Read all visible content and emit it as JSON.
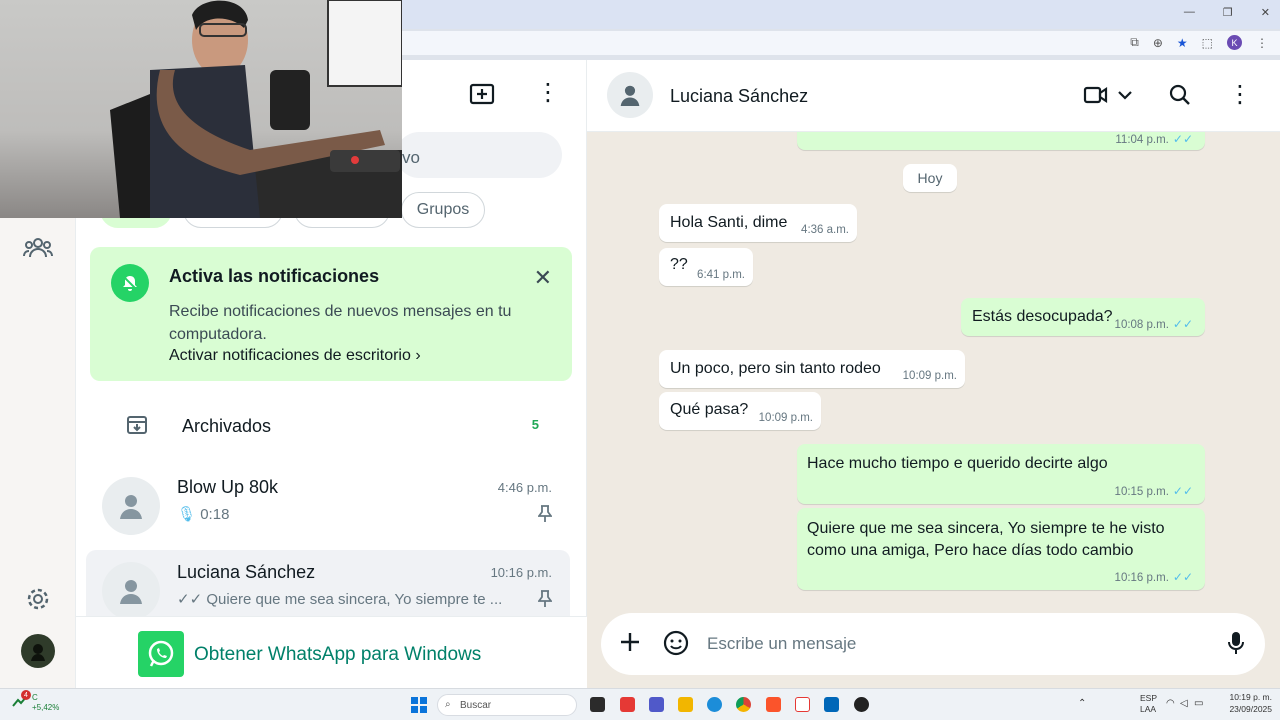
{
  "browser": {
    "profile_initial": "K"
  },
  "sidebar": {
    "search_placeholder_fragment": "vo",
    "chips": [
      {
        "label": ""
      },
      {
        "label": ""
      },
      {
        "label": ""
      },
      {
        "label": "Grupos"
      }
    ],
    "notification": {
      "title": "Activa las notificaciones",
      "body": "Recibe notificaciones de nuevos mensajes en tu computadora.",
      "link": "Activar notificaciones de escritorio"
    },
    "archived": {
      "label": "Archivados",
      "count": "5"
    },
    "chats": [
      {
        "name": "Blow Up 80k",
        "time": "4:46 p.m.",
        "preview": "0:18",
        "pinned": true
      },
      {
        "name": "Luciana Sánchez",
        "time": "10:16 p.m.",
        "preview": "Quiere que me sea sincera, Yo siempre te ...",
        "pinned": true
      }
    ],
    "get_windows": "Obtener WhatsApp para Windows"
  },
  "conversation": {
    "contact_name": "Luciana Sánchez",
    "top_partial_time": "11:04 p.m.",
    "day_label": "Hoy",
    "messages": [
      {
        "dir": "in",
        "text": "Hola Santi, dime",
        "time": "4:36 a.m."
      },
      {
        "dir": "in",
        "text": "??",
        "time": "6:41 p.m."
      },
      {
        "dir": "out",
        "text": "Estás desocupada?",
        "time": "10:08 p.m."
      },
      {
        "dir": "in",
        "text": "Un poco, pero sin tanto rodeo",
        "time": "10:09 p.m."
      },
      {
        "dir": "in",
        "text": "Qué pasa?",
        "time": "10:09 p.m."
      },
      {
        "dir": "out",
        "text": "Hace mucho tiempo e querido decirte algo",
        "time": "10:15 p.m."
      },
      {
        "dir": "out",
        "text": "Quiere que me sea sincera, Yo siempre te he visto como una amiga, Pero hace días todo cambio",
        "time": "10:16 p.m."
      }
    ],
    "composer_placeholder": "Escribe un mensaje"
  },
  "taskbar": {
    "search_label": "Buscar",
    "stock_badge": "4",
    "stock_label": "C",
    "stock_change": "+5,42%",
    "lang": "ESP",
    "lang_region": "LAA",
    "time": "10:19 p. m.",
    "date": "23/09/2025"
  },
  "colors": {
    "accent": "#25d366",
    "bubble_out": "#d9fdd3",
    "chat_bg": "#efeae2",
    "ticks": "#53bdeb"
  }
}
